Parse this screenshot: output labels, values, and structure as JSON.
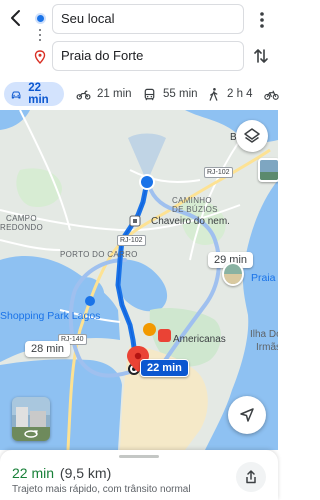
{
  "header": {
    "origin_value": "Seu local",
    "destination_value": "Praia do Forte"
  },
  "modes": [
    {
      "name": "car",
      "label": "22 min",
      "active": true
    },
    {
      "name": "motorcycle",
      "label": "21 min",
      "active": false
    },
    {
      "name": "transit",
      "label": "55 min",
      "active": false
    },
    {
      "name": "walk",
      "label": "2 h 4",
      "active": false
    },
    {
      "name": "bike",
      "label": "",
      "active": false
    }
  ],
  "map": {
    "labels": {
      "caminho_de_buzios": "CAMINHO\nDE BÚZIOS",
      "campo_redondo_1": "CAMPO",
      "campo_redondo_2": "REDONDO",
      "porto_do_carro": "PORTO DO CARRO"
    },
    "places": {
      "chaveiro": "Chaveiro do nem.",
      "americanas": "Americanas",
      "shopping": "Shopping Park Lagos",
      "praia": "Praia d",
      "ilha": "Ilha Do",
      "irmas": "Irmãs",
      "ba": "Ba"
    },
    "road_shields": {
      "rj102_top": "RJ-102",
      "rj102_mid": "RJ-102",
      "rj140": "RJ-140"
    },
    "route_times": {
      "main": "22 min",
      "alt_right": "29 min",
      "alt_left": "28 min"
    },
    "colors": {
      "route": "#1a73e8",
      "route_alt": "#9fc0ef",
      "water": "#8ec1f2",
      "land": "#e6ebe6",
      "green": "#c8e6c9"
    }
  },
  "sheet": {
    "time": "22 min",
    "distance": "(9,5 km)",
    "subtitle": "Trajeto mais rápido, com trânsito normal"
  }
}
